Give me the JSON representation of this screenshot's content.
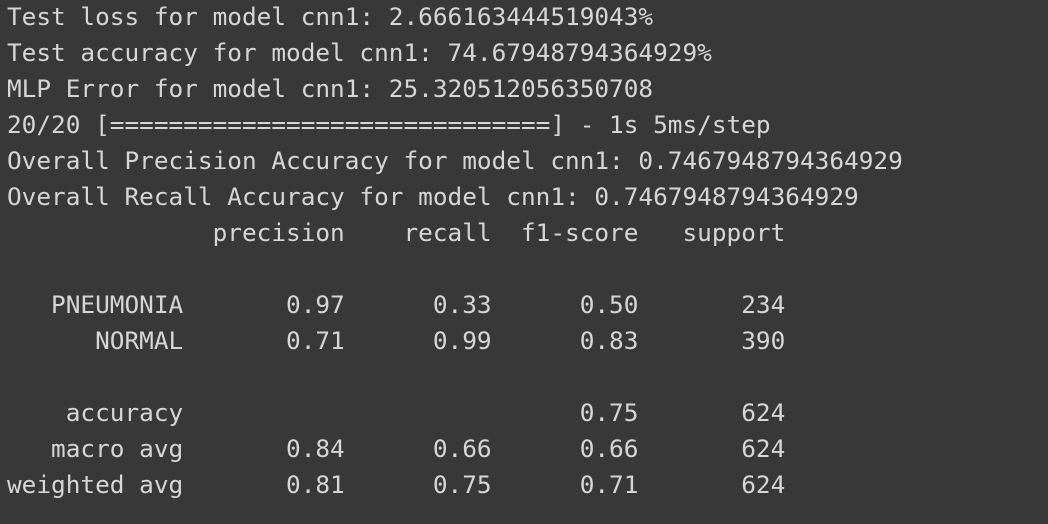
{
  "output": {
    "lines": [
      "Test loss for model cnn1: 2.6661634445190 43%",
      "",
      "",
      "",
      "",
      "",
      "",
      "",
      "",
      "",
      "",
      "",
      "",
      ""
    ]
  }
}
